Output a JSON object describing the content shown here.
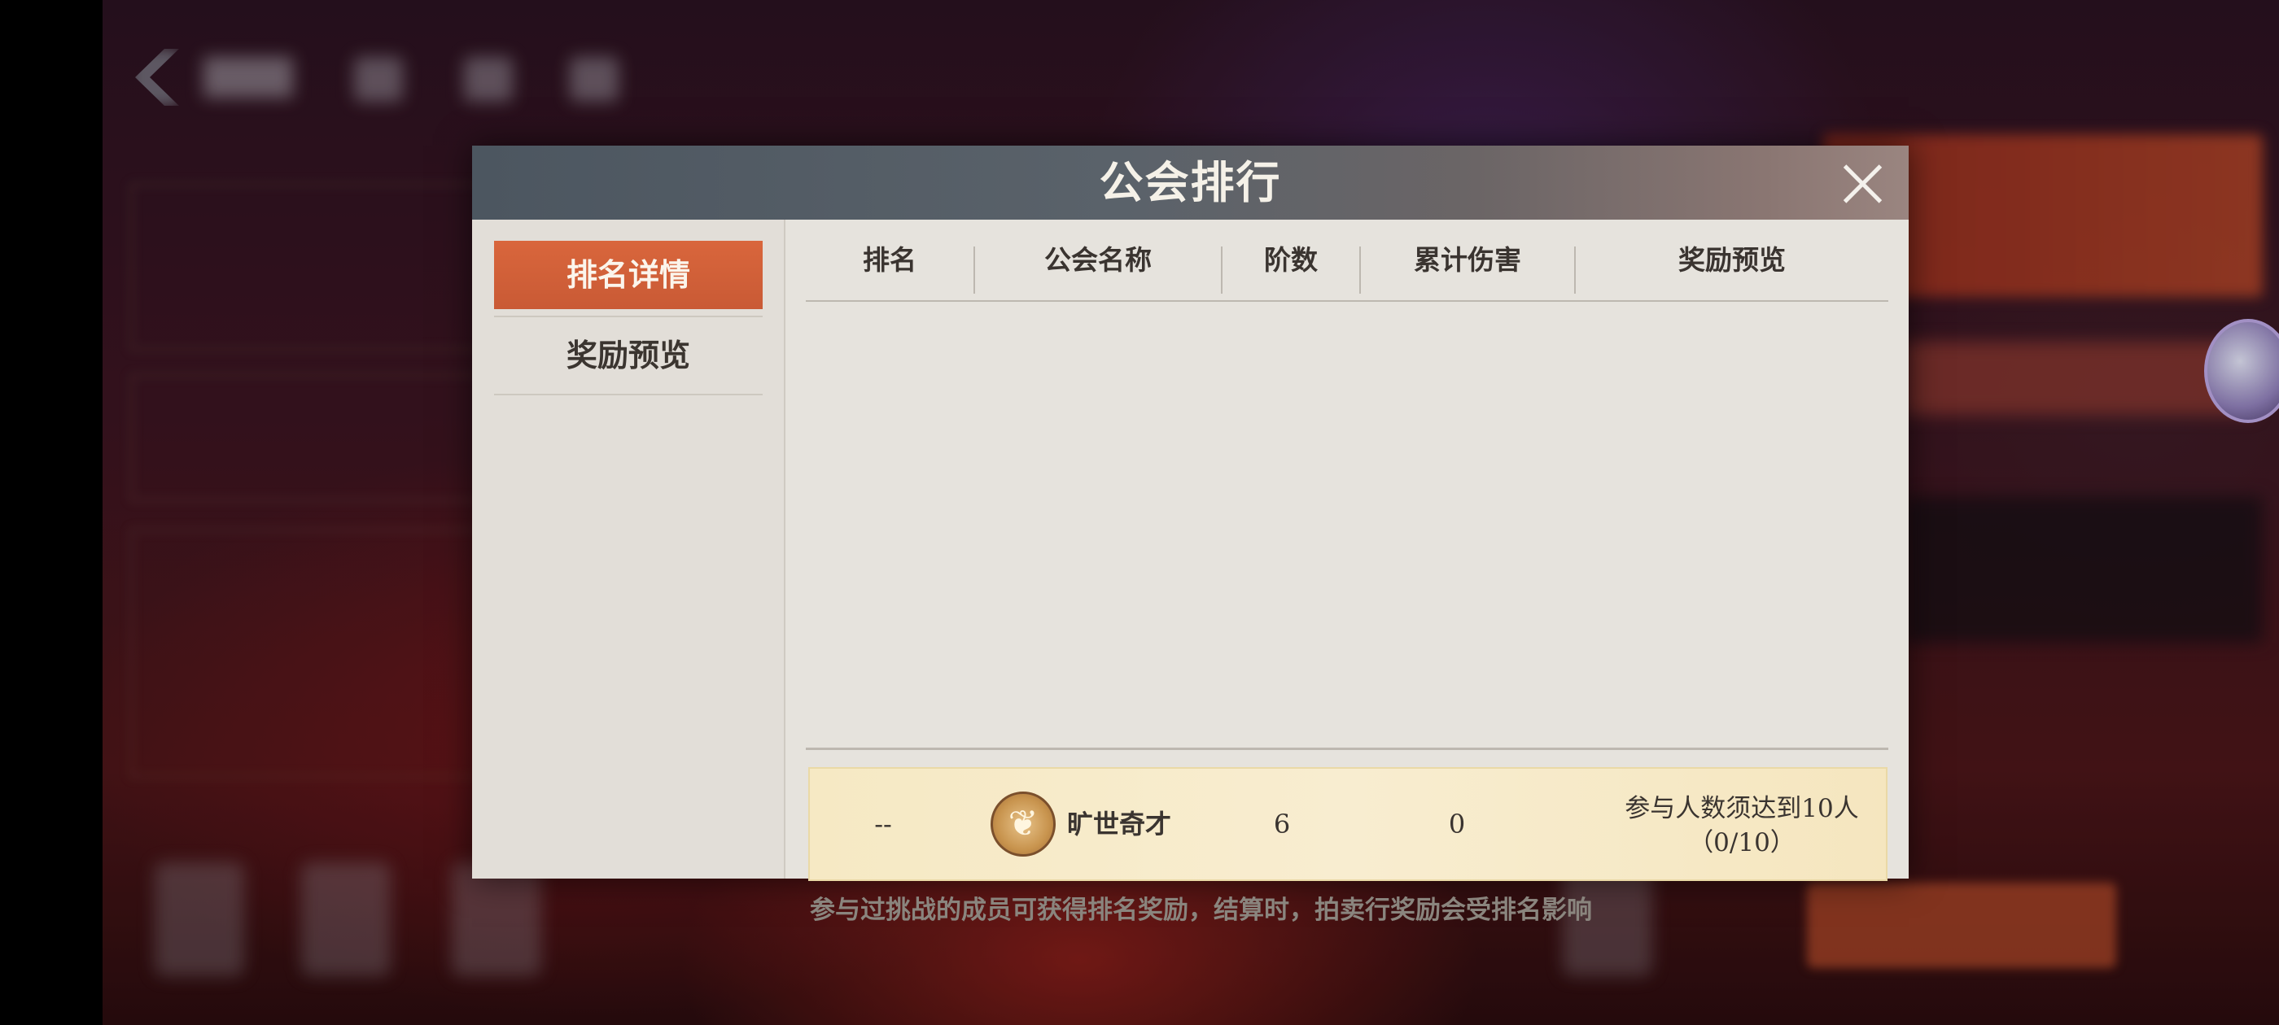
{
  "modal": {
    "title": "公会排行",
    "close_icon": "close-icon"
  },
  "sidebar": {
    "items": [
      {
        "label": "排名详情",
        "active": true
      },
      {
        "label": "奖励预览",
        "active": false
      }
    ]
  },
  "table": {
    "headers": [
      "排名",
      "公会名称",
      "阶数",
      "累计伤害",
      "奖励预览"
    ],
    "rows": []
  },
  "my_guild": {
    "rank": "--",
    "emblem_icon": "phoenix-emblem-icon",
    "name": "旷世奇才",
    "tier": "6",
    "damage": "0",
    "reward_line1": "参与人数须达到10人",
    "reward_line2": "（0/10）"
  },
  "footnote": "参与过挑战的成员可获得排名奖励，结算时，拍卖行奖励会受排名影响",
  "colors": {
    "accent_tab": "#d9663c",
    "header_bg": "#4c5660",
    "my_row_bg": "#f6e9c4"
  }
}
